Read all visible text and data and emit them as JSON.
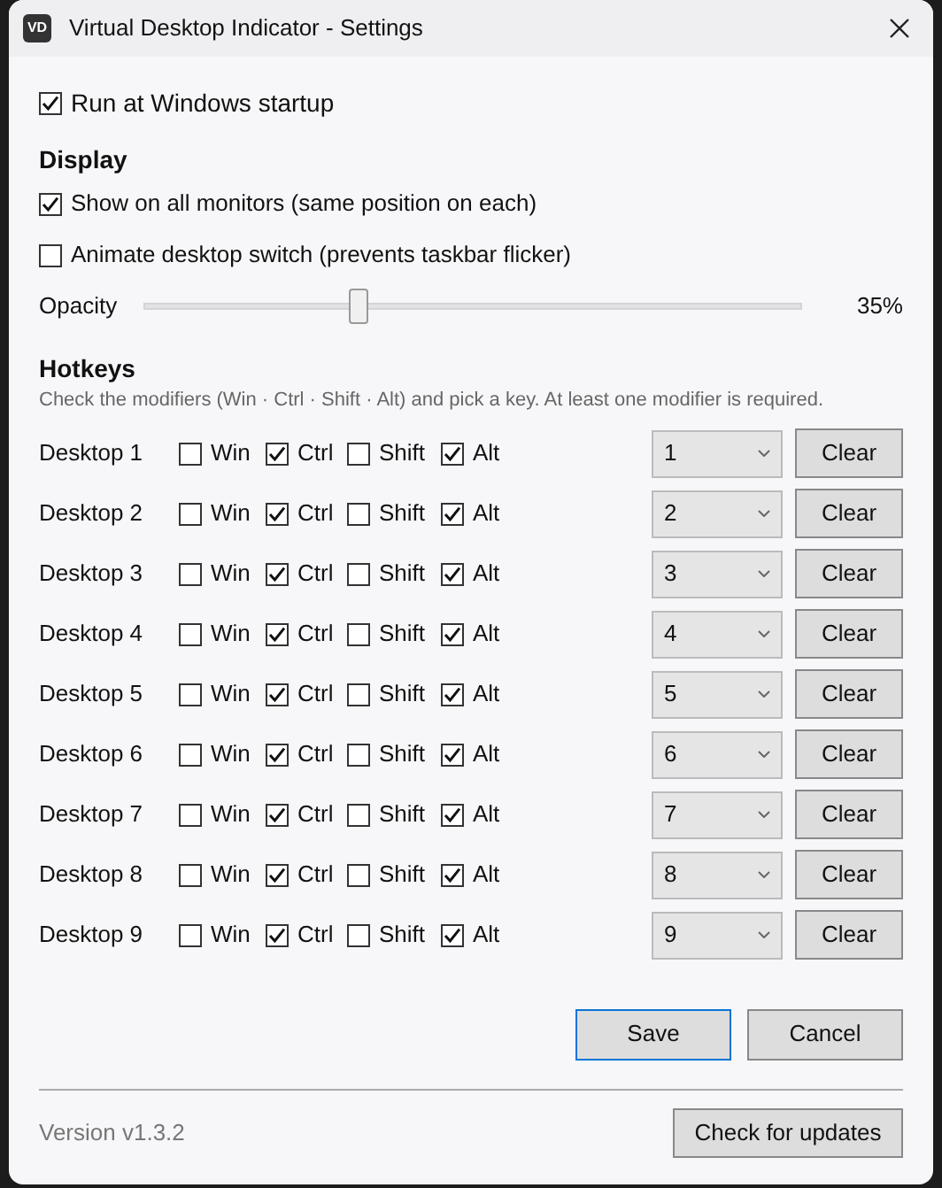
{
  "window": {
    "title": "Virtual Desktop Indicator - Settings",
    "app_icon": "VD"
  },
  "startup": {
    "label": "Run at Windows startup",
    "checked": true
  },
  "display": {
    "heading": "Display",
    "options": [
      {
        "label": "Show on all monitors (same position on each)",
        "checked": true
      },
      {
        "label": "Animate desktop switch (prevents taskbar flicker)",
        "checked": false
      }
    ],
    "opacity": {
      "label": "Opacity",
      "level": 0.32,
      "reading": "35%"
    }
  },
  "hotkeys": {
    "heading": "Hotkeys",
    "description": "Check the modifiers (Win · Ctrl · Shift · Alt) and pick a key. At least one modifier is required.",
    "rows": [
      {
        "label": "Desktop 1",
        "modifiers": [
          {
            "label": "Win",
            "checked": false
          },
          {
            "label": "Ctrl",
            "checked": true
          },
          {
            "label": "Shift",
            "checked": false
          },
          {
            "label": "Alt",
            "checked": true
          }
        ],
        "key": "1",
        "clear": "Clear"
      },
      {
        "label": "Desktop 2",
        "modifiers": [
          {
            "label": "Win",
            "checked": false
          },
          {
            "label": "Ctrl",
            "checked": true
          },
          {
            "label": "Shift",
            "checked": false
          },
          {
            "label": "Alt",
            "checked": true
          }
        ],
        "key": "2",
        "clear": "Clear"
      },
      {
        "label": "Desktop 3",
        "modifiers": [
          {
            "label": "Win",
            "checked": false
          },
          {
            "label": "Ctrl",
            "checked": true
          },
          {
            "label": "Shift",
            "checked": false
          },
          {
            "label": "Alt",
            "checked": true
          }
        ],
        "key": "3",
        "clear": "Clear"
      },
      {
        "label": "Desktop 4",
        "modifiers": [
          {
            "label": "Win",
            "checked": false
          },
          {
            "label": "Ctrl",
            "checked": true
          },
          {
            "label": "Shift",
            "checked": false
          },
          {
            "label": "Alt",
            "checked": true
          }
        ],
        "key": "4",
        "clear": "Clear"
      },
      {
        "label": "Desktop 5",
        "modifiers": [
          {
            "label": "Win",
            "checked": false
          },
          {
            "label": "Ctrl",
            "checked": true
          },
          {
            "label": "Shift",
            "checked": false
          },
          {
            "label": "Alt",
            "checked": true
          }
        ],
        "key": "5",
        "clear": "Clear"
      },
      {
        "label": "Desktop 6",
        "modifiers": [
          {
            "label": "Win",
            "checked": false
          },
          {
            "label": "Ctrl",
            "checked": true
          },
          {
            "label": "Shift",
            "checked": false
          },
          {
            "label": "Alt",
            "checked": true
          }
        ],
        "key": "6",
        "clear": "Clear"
      },
      {
        "label": "Desktop 7",
        "modifiers": [
          {
            "label": "Win",
            "checked": false
          },
          {
            "label": "Ctrl",
            "checked": true
          },
          {
            "label": "Shift",
            "checked": false
          },
          {
            "label": "Alt",
            "checked": true
          }
        ],
        "key": "7",
        "clear": "Clear"
      },
      {
        "label": "Desktop 8",
        "modifiers": [
          {
            "label": "Win",
            "checked": false
          },
          {
            "label": "Ctrl",
            "checked": true
          },
          {
            "label": "Shift",
            "checked": false
          },
          {
            "label": "Alt",
            "checked": true
          }
        ],
        "key": "8",
        "clear": "Clear"
      },
      {
        "label": "Desktop 9",
        "modifiers": [
          {
            "label": "Win",
            "checked": false
          },
          {
            "label": "Ctrl",
            "checked": true
          },
          {
            "label": "Shift",
            "checked": false
          },
          {
            "label": "Alt",
            "checked": true
          }
        ],
        "key": "9",
        "clear": "Clear"
      }
    ]
  },
  "buttons": [
    {
      "label": "Save",
      "focused": true
    },
    {
      "label": "Cancel",
      "focused": false
    }
  ],
  "footer": {
    "version": "Version v1.3.2",
    "update_button": "Check for updates"
  }
}
